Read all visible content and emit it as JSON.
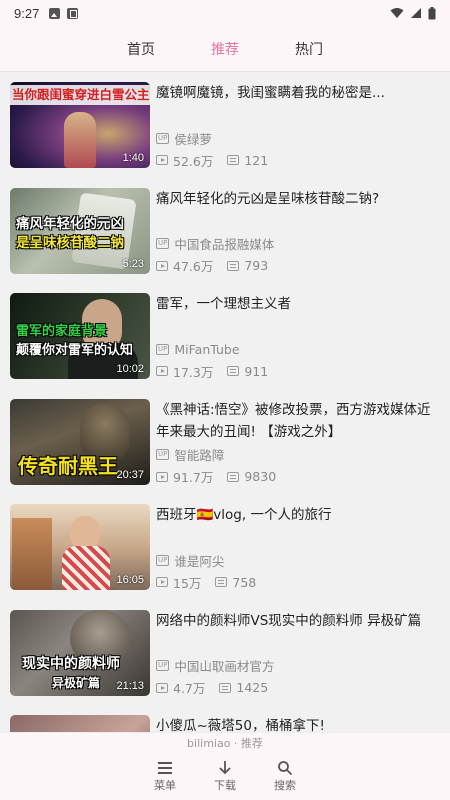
{
  "status": {
    "time": "9:27"
  },
  "tabs": [
    {
      "label": "首页",
      "active": false
    },
    {
      "label": "推荐",
      "active": true
    },
    {
      "label": "热门",
      "active": false
    }
  ],
  "videos": [
    {
      "title": "魔镜啊魔镜，我闺蜜瞒着我的秘密是...",
      "uploader": "侯绿萝",
      "views": "52.6万",
      "danmaku": "121",
      "duration": "1:40",
      "thumb_text": "当你跟闺蜜穿进白雪公主"
    },
    {
      "title": "痛风年轻化的元凶是呈味核苷酸二钠?",
      "uploader": "中国食品报融媒体",
      "views": "47.6万",
      "danmaku": "793",
      "duration": "5:23",
      "thumb_text": "痛风年轻化的元凶 是呈味核苷酸二钠"
    },
    {
      "title": "雷军，一个理想主义者",
      "uploader": "MiFanTube",
      "views": "17.3万",
      "danmaku": "911",
      "duration": "10:02",
      "thumb_text": "雷军的家庭背景 颠覆你对雷军的认知"
    },
    {
      "title": "《黑神话:悟空》被修改投票，西方游戏媒体近年来最大的丑闻! 【游戏之外】",
      "uploader": "智能路障",
      "views": "91.7万",
      "danmaku": "9830",
      "duration": "20:37",
      "thumb_text": "传奇耐黑王"
    },
    {
      "title": "西班牙🇪🇸vlog, 一个人的旅行",
      "uploader": "谁是阿尖",
      "views": "15万",
      "danmaku": "758",
      "duration": "16:05",
      "thumb_text": ""
    },
    {
      "title": "网络中的颜料师VS现实中的颜料师 异极矿篇",
      "uploader": "中国山取画材官方",
      "views": "4.7万",
      "danmaku": "1425",
      "duration": "21:13",
      "thumb_text": "现实中的颜料师 异极矿篇"
    },
    {
      "title": "小傻瓜~薇塔50，桶桶拿下!",
      "uploader": "",
      "views": "",
      "danmaku": "",
      "duration": "",
      "thumb_text": ""
    }
  ],
  "footer": {
    "app_label": "bilimiao · 推荐",
    "nav": [
      {
        "label": "菜单",
        "icon": "menu-icon"
      },
      {
        "label": "下载",
        "icon": "download-icon"
      },
      {
        "label": "搜索",
        "icon": "search-icon"
      }
    ]
  },
  "colors": {
    "accent": "#e8739a",
    "background": "#fdf6f8",
    "list_bg": "#f1f1f1"
  }
}
